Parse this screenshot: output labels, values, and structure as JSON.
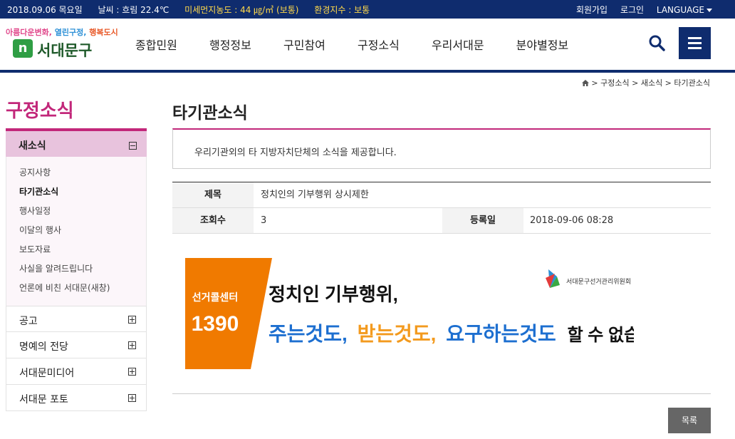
{
  "topbar": {
    "date": "2018.09.06 목요일",
    "weather": "날씨 : 흐림 22.4℃",
    "dust": "미세먼지농도 : 44 ㎍/㎥ (보통)",
    "env": "환경지수 : 보통",
    "join": "회원가입",
    "login": "로그인",
    "language": "LANGUAGE"
  },
  "logo": {
    "slogan_1": "아름다운변화,",
    "slogan_2": "열린구정,",
    "slogan_3": "행복도시",
    "name": "서대문구"
  },
  "gnb": [
    "종합민원",
    "행정정보",
    "구민참여",
    "구정소식",
    "우리서대문",
    "분야별정보"
  ],
  "icons": {
    "search": "search-icon",
    "menu": "hamburger-menu-icon",
    "home": "home-icon"
  },
  "breadcrumb": "> 구정소식 > 새소식 > 타기관소식",
  "lnb": {
    "title": "구정소식",
    "active": "새소식",
    "sub": [
      "공지사항",
      "타기관소식",
      "행사일정",
      "이달의 행사",
      "보도자료",
      "사실을 알려드립니다",
      "언론에 비친 서대문(새창)"
    ],
    "items": [
      "공고",
      "명예의 전당",
      "서대문미디어",
      "서대문 포토"
    ]
  },
  "content": {
    "title": "타기관소식",
    "intro": "우리기관외의 타 지방자치단체의 소식을 제공합니다.",
    "subject_label": "제목",
    "subject": "정치인의 기부행위 상시제한",
    "views_label": "조회수",
    "views": "3",
    "date_label": "등록일",
    "date": "2018-09-06 08:28",
    "list_button": "목록"
  },
  "banner": {
    "center": "선거콜센터",
    "phone": "1390",
    "line1": "정치인 기부행위,",
    "part_a": "주는것도,",
    "part_b": "받는것도,",
    "part_c": "요구하는것도",
    "part_d": "할 수 없습니다",
    "org": "서대문구선거관리위원회"
  },
  "colors": {
    "navy": "#0f2c6e",
    "magenta": "#c2277a",
    "orange": "#f39a1e",
    "blue": "#1d6fd0",
    "banner_orange": "#f07a00"
  }
}
